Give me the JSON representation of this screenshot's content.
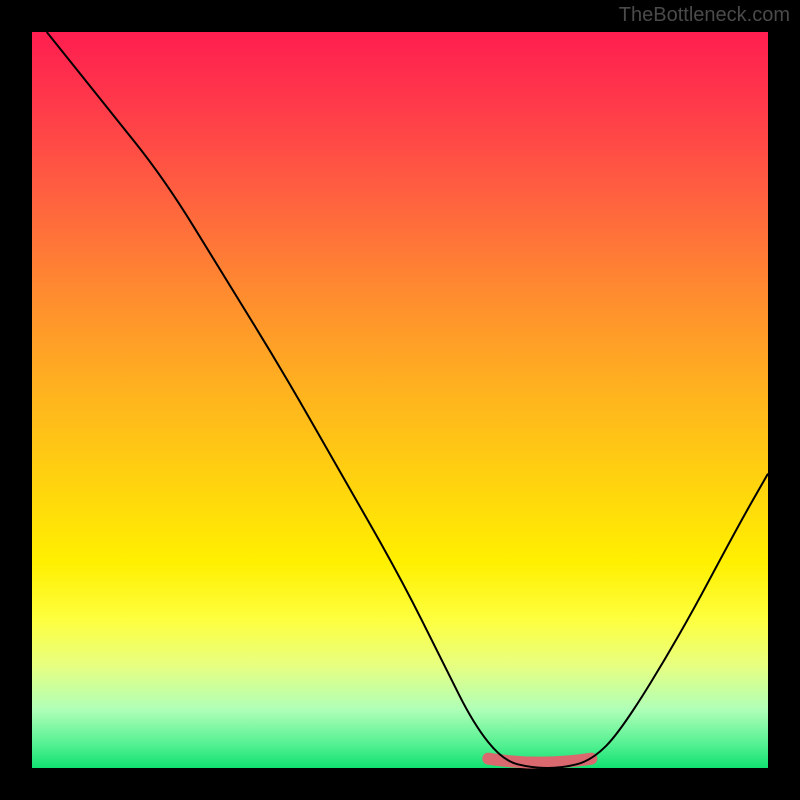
{
  "watermark": "TheBottleneck.com",
  "chart_data": {
    "type": "line",
    "title": "",
    "xlabel": "",
    "ylabel": "",
    "xlim": [
      0,
      100
    ],
    "ylim": [
      0,
      100
    ],
    "series": [
      {
        "name": "bottleneck-curve",
        "x": [
          2,
          10,
          18,
          26,
          34,
          42,
          50,
          56,
          60,
          64,
          68,
          72,
          76,
          80,
          88,
          96,
          100
        ],
        "y": [
          100,
          90,
          80,
          67,
          54,
          40,
          26,
          14,
          6,
          1,
          0,
          0,
          1,
          5,
          18,
          33,
          40
        ]
      }
    ],
    "highlight": {
      "name": "optimal-range",
      "x_start": 62,
      "x_end": 76,
      "y": 1
    },
    "grid": false,
    "background_gradient": {
      "top": "#ff1e50",
      "bottom": "#10e070",
      "meaning": "red-high-bottleneck green-low-bottleneck"
    }
  }
}
